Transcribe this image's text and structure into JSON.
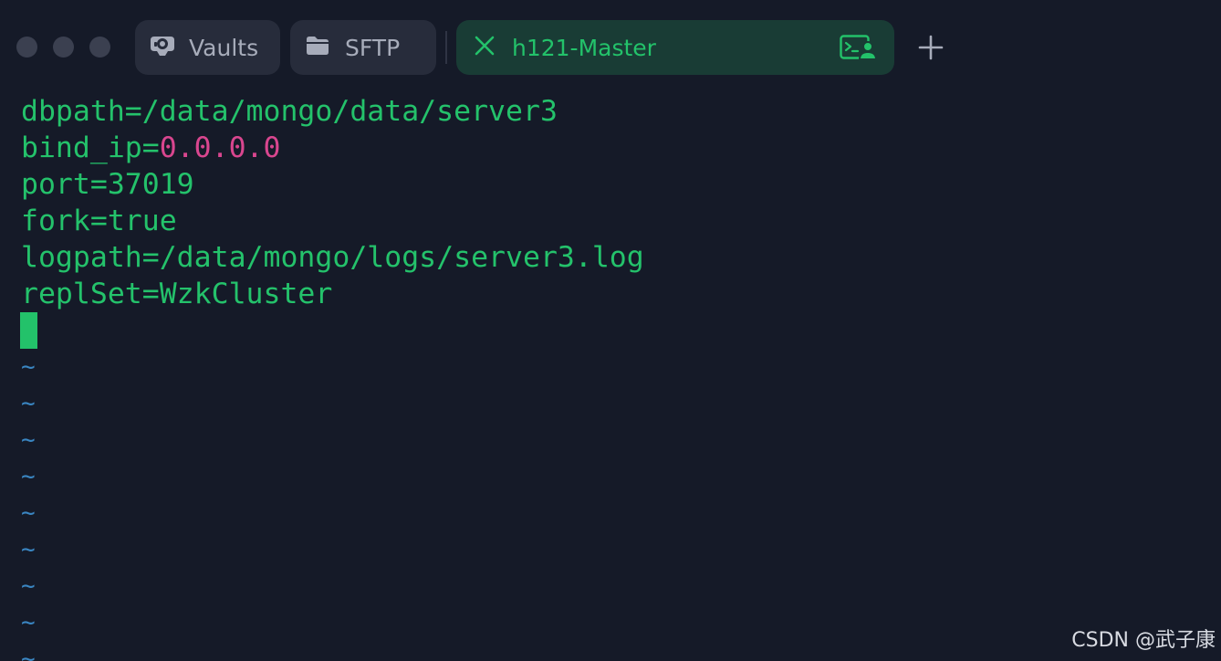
{
  "window": {
    "tabs": [
      {
        "label": "Vaults",
        "icon": "vault-icon",
        "active": false
      },
      {
        "label": "SFTP",
        "icon": "folder-icon",
        "active": false
      },
      {
        "label": "h121-Master",
        "icon": "close-icon",
        "active": true,
        "trailing_icon": "terminal-user-icon"
      }
    ],
    "new_tab_icon": "plus-icon"
  },
  "terminal": {
    "lines": [
      {
        "text": "dbpath=/data/mongo/data/server3"
      },
      {
        "key": "bind_ip=",
        "value": "0.0.0.0"
      },
      {
        "text": "port=37019"
      },
      {
        "text": "fork=true"
      },
      {
        "text": "logpath=/data/mongo/logs/server3.log"
      },
      {
        "text": "replSet=WzkCluster"
      }
    ],
    "empty_line_marker": "~"
  },
  "watermark": "CSDN @武子康",
  "colors": {
    "background": "#151a28",
    "text_green": "#24c26b",
    "value_pink": "#d9468f",
    "tilde_blue": "#3a86c2",
    "active_tab_bg": "#193c35",
    "tab_bg": "#272c3b"
  }
}
